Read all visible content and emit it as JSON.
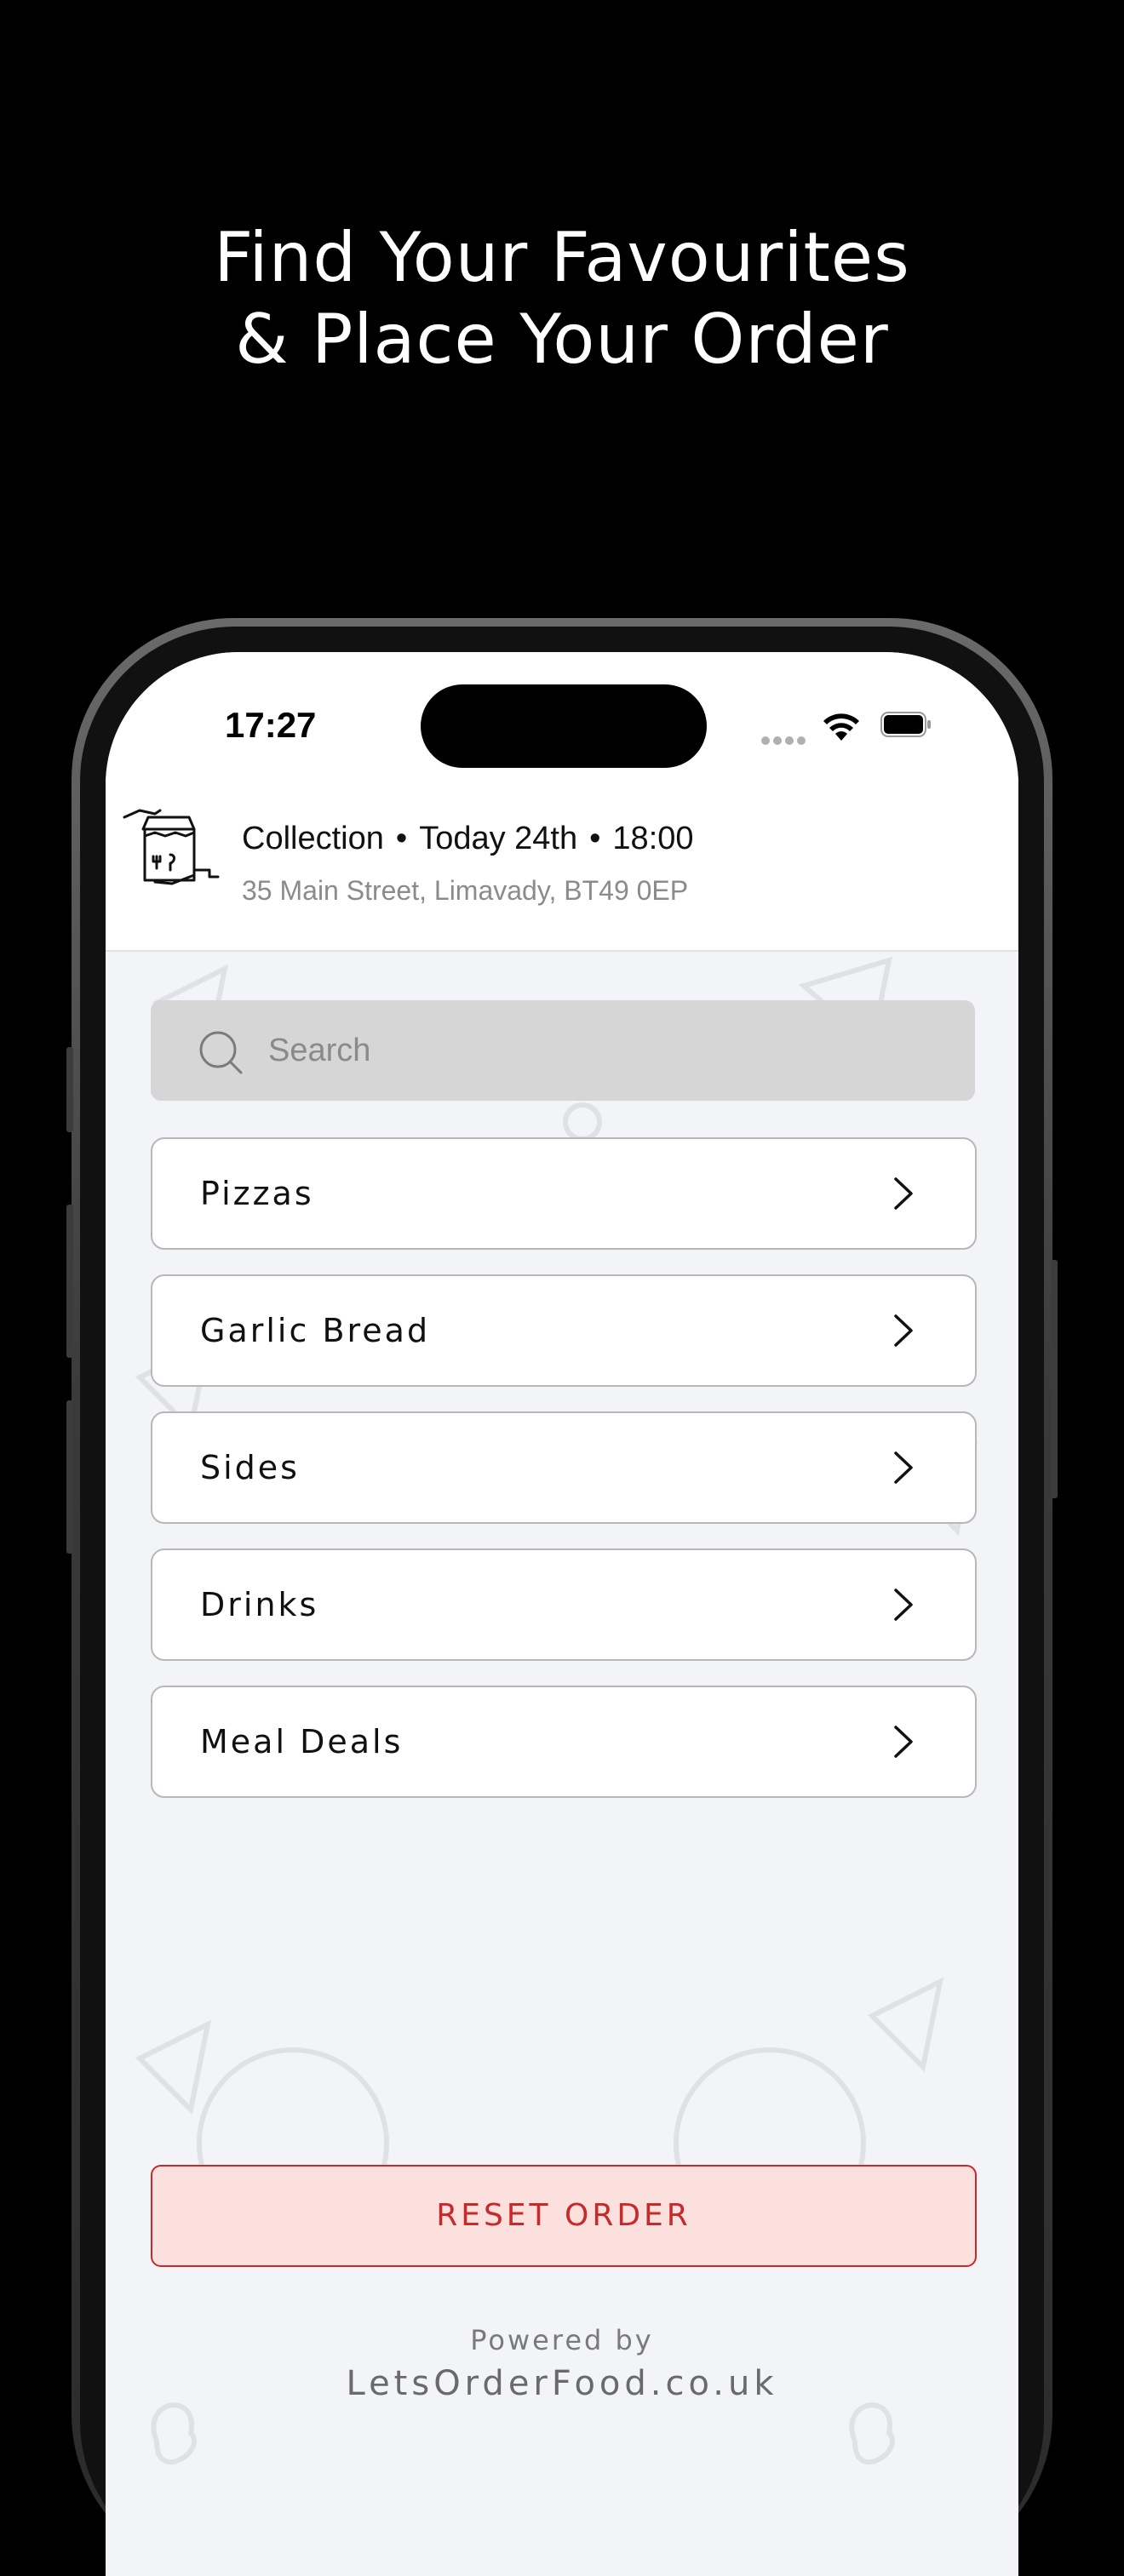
{
  "promo": {
    "headline_line1": "Find Your Favourites",
    "headline_line2": "& Place Your Order"
  },
  "status_bar": {
    "time": "17:27"
  },
  "order_header": {
    "mode": "Collection",
    "day": "Today 24th",
    "time": "18:00",
    "address": "35 Main Street, Limavady, BT49  0EP",
    "icon": "takeaway-bag-icon"
  },
  "search": {
    "placeholder": "Search"
  },
  "categories": [
    {
      "label": "Pizzas"
    },
    {
      "label": "Garlic Bread"
    },
    {
      "label": "Sides"
    },
    {
      "label": "Drinks"
    },
    {
      "label": "Meal Deals"
    }
  ],
  "reset": {
    "label": "RESET ORDER"
  },
  "footer": {
    "powered_by": "Powered by",
    "brand": "LetsOrderFood.co.uk"
  },
  "colors": {
    "accent": "#c72a2a",
    "reset_bg": "#fbe0dd",
    "page_bg": "#f3f4f7"
  }
}
